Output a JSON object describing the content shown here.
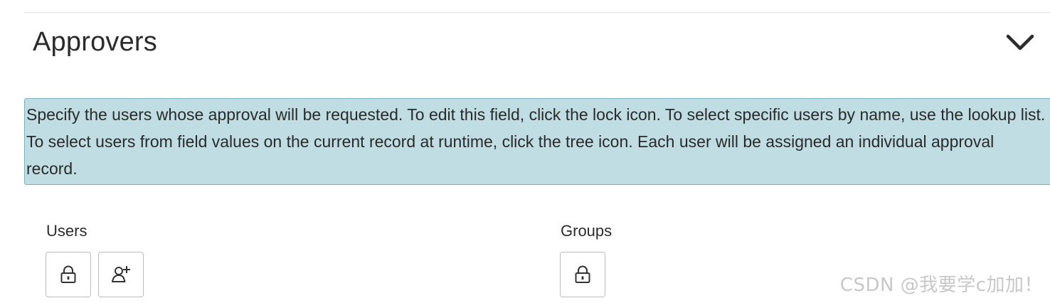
{
  "section": {
    "title": "Approvers",
    "toggle_icon": "chevron-down-icon"
  },
  "info": {
    "text": "Specify the users whose approval will be requested. To edit this field, click the lock icon. To select specific users by name, use the lookup list. To select users from field values on the current record at runtime, click the tree icon. Each user will be assigned an individual approval record."
  },
  "users": {
    "label": "Users",
    "buttons": [
      {
        "icon": "lock-icon"
      },
      {
        "icon": "add-user-icon"
      }
    ]
  },
  "groups": {
    "label": "Groups",
    "buttons": [
      {
        "icon": "lock-icon"
      }
    ]
  },
  "watermark": {
    "text": "CSDN @我要学c加加！"
  }
}
